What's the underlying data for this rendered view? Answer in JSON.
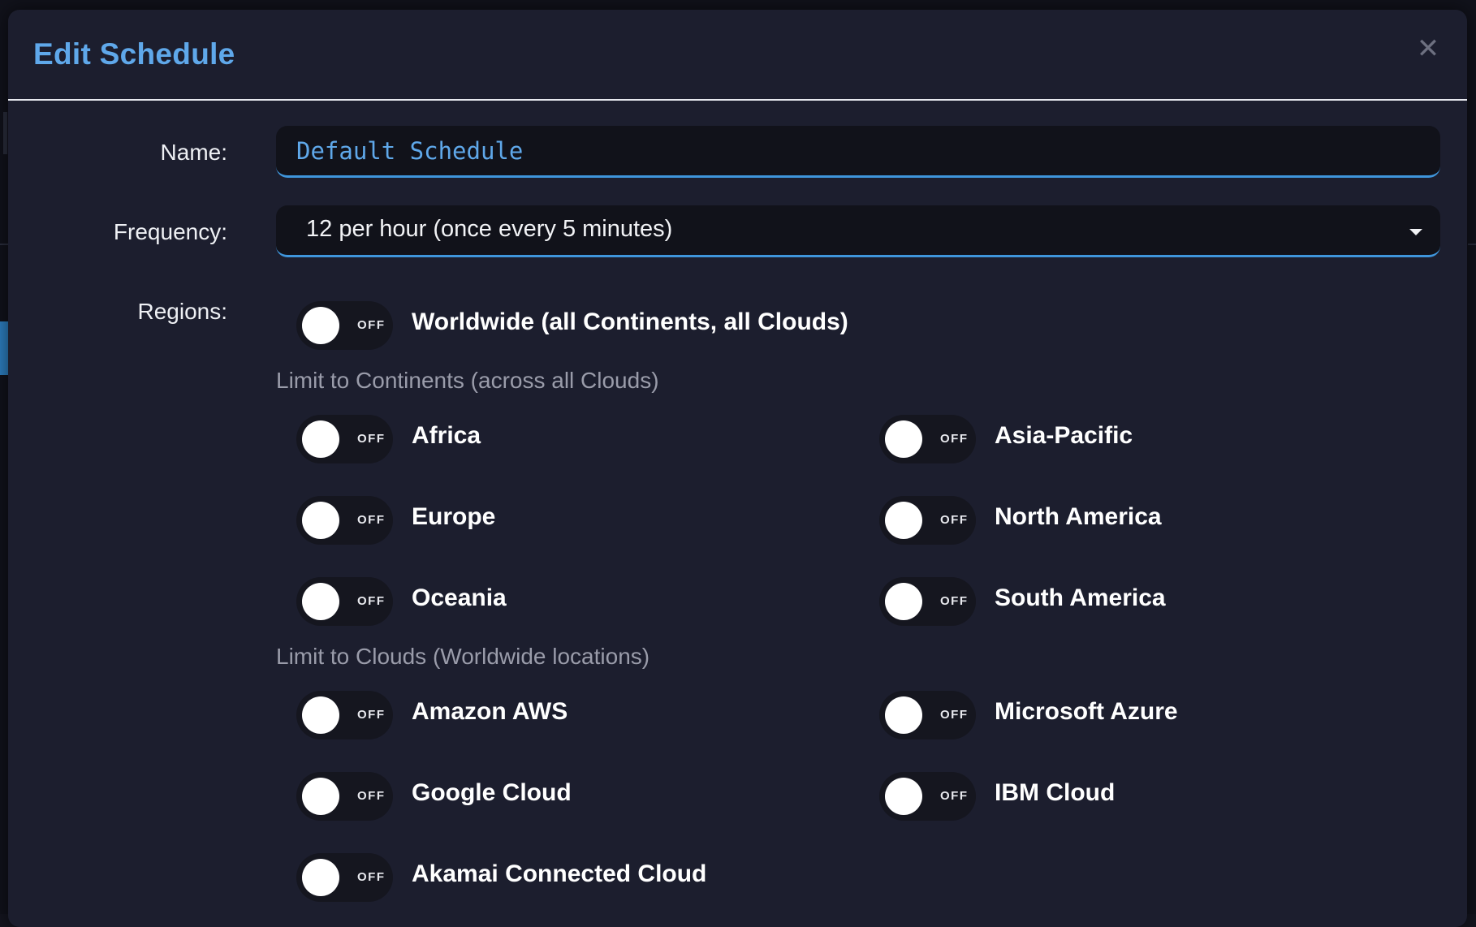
{
  "dialog": {
    "title": "Edit Schedule",
    "close_icon": "close-icon"
  },
  "form": {
    "name_label": "Name:",
    "name_value": "Default Schedule",
    "frequency_label": "Frequency:",
    "frequency_value": "12 per hour (once every 5 minutes)",
    "regions_label": "Regions:"
  },
  "worldwide": {
    "label": "Worldwide (all Continents, all Clouds)",
    "state": "OFF"
  },
  "continents": {
    "heading": "Limit to Continents (across all Clouds)",
    "items": [
      {
        "label": "Africa",
        "state": "OFF"
      },
      {
        "label": "Asia-Pacific",
        "state": "OFF"
      },
      {
        "label": "Europe",
        "state": "OFF"
      },
      {
        "label": "North America",
        "state": "OFF"
      },
      {
        "label": "Oceania",
        "state": "OFF"
      },
      {
        "label": "South America",
        "state": "OFF"
      }
    ]
  },
  "clouds": {
    "heading": "Limit to Clouds (Worldwide locations)",
    "items": [
      {
        "label": "Amazon AWS",
        "state": "OFF"
      },
      {
        "label": "Microsoft Azure",
        "state": "OFF"
      },
      {
        "label": "Google Cloud",
        "state": "OFF"
      },
      {
        "label": "IBM Cloud",
        "state": "OFF"
      },
      {
        "label": "Akamai Connected Cloud",
        "state": "OFF"
      }
    ]
  },
  "colors": {
    "accent": "#5fa8ea",
    "modal_bg": "#1c1e2e",
    "input_bg": "#11121a",
    "underline": "#3f95db"
  }
}
